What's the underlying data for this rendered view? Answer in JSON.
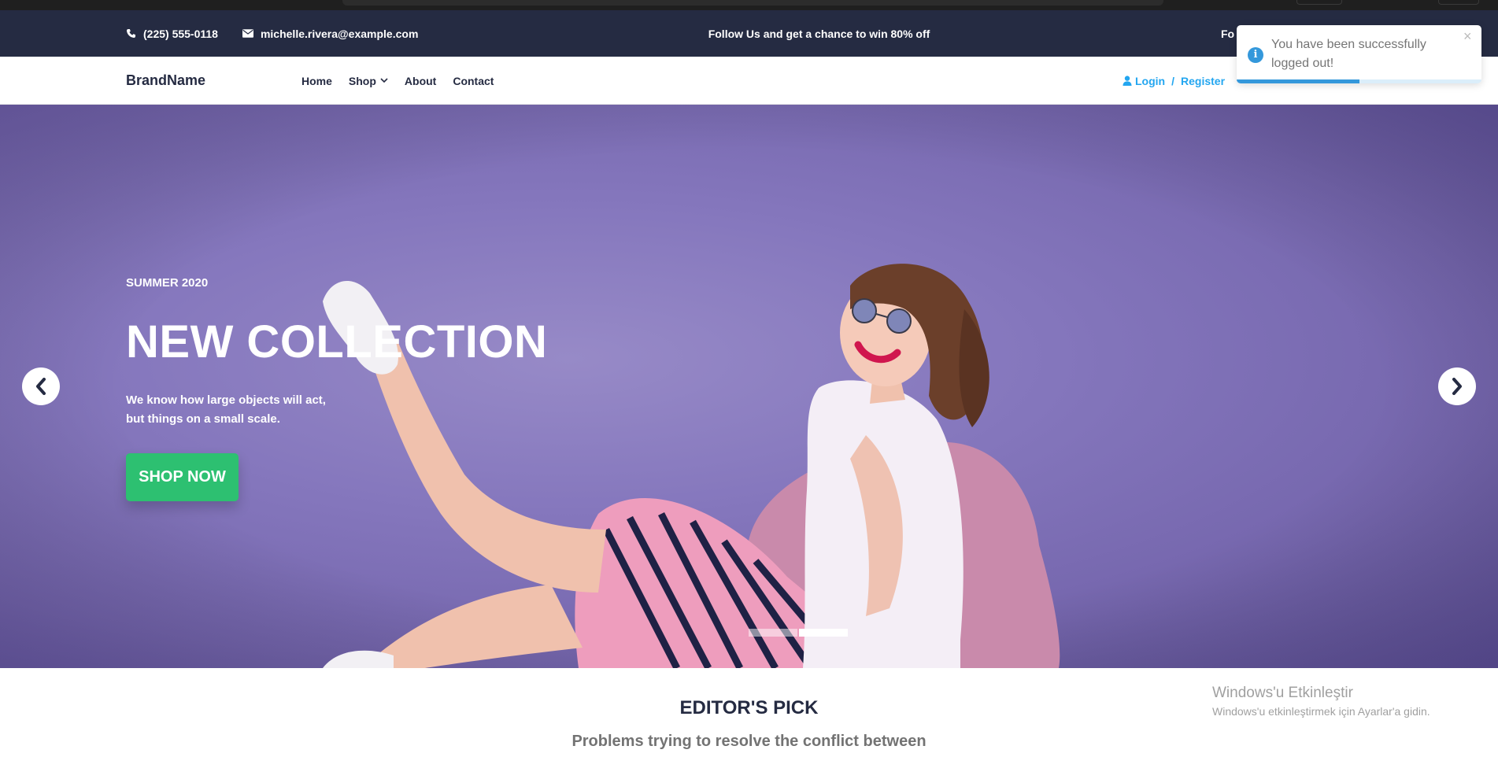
{
  "topbar": {
    "phone": "(225) 555-0118",
    "email": "michelle.rivera@example.com",
    "promo": "Follow Us and get a chance to win 80% off",
    "follow_label": "Fo"
  },
  "navbar": {
    "brand": "BrandName",
    "menu": {
      "home": "Home",
      "shop": "Shop",
      "about": "About",
      "contact": "Contact"
    },
    "auth": {
      "login": "Login",
      "separator": "/",
      "register": "Register"
    }
  },
  "hero": {
    "subtitle": "SUMMER 2020",
    "title": "NEW COLLECTION",
    "desc_line1": "We know how large objects will act,",
    "desc_line2": "but things on a small scale.",
    "cta": "SHOP NOW",
    "slides": {
      "count": 2,
      "active_index": 1
    }
  },
  "editors_pick": {
    "heading": "EDITOR'S PICK",
    "subheading": "Problems trying to resolve the conflict between"
  },
  "toast": {
    "message": "You have been successfully logged out!",
    "close": "×",
    "progress_remaining": 0.5
  },
  "watermark": {
    "line1": "Windows'u Etkinleştir",
    "line2": "Windows'u etkinleştirmek için Ayarlar'a gidin."
  },
  "colors": {
    "topbar_bg": "#252b42",
    "accent_blue": "#23a6f0",
    "cta_green": "#2dc071",
    "hero_purple": "#8577bd",
    "toast_blue": "#3498db"
  },
  "icons": {
    "phone": "phone-icon",
    "email": "envelope-icon",
    "dropdown": "chevron-down-icon",
    "user": "user-icon",
    "prev": "chevron-left-icon",
    "next": "chevron-right-icon",
    "toast_info": "info-icon",
    "toast_close": "close-icon"
  }
}
